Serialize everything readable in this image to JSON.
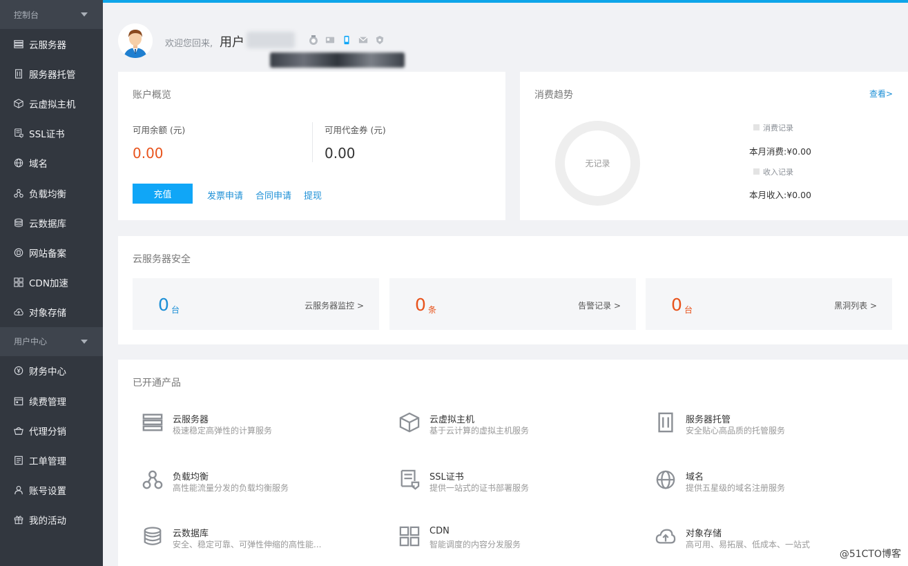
{
  "sidebar": {
    "section1": "控制台",
    "items1": [
      {
        "label": "云服务器",
        "icon": "server-icon"
      },
      {
        "label": "服务器托管",
        "icon": "rack-icon"
      },
      {
        "label": "云虚拟主机",
        "icon": "cube-icon"
      },
      {
        "label": "SSL证书",
        "icon": "certificate-icon"
      },
      {
        "label": "域名",
        "icon": "globe-icon"
      },
      {
        "label": "负载均衡",
        "icon": "balance-icon"
      },
      {
        "label": "云数据库",
        "icon": "database-icon"
      },
      {
        "label": "网站备案",
        "icon": "record-icon"
      },
      {
        "label": "CDN加速",
        "icon": "cdn-icon"
      },
      {
        "label": "对象存储",
        "icon": "cloud-upload-icon"
      }
    ],
    "section2": "用户中心",
    "items2": [
      {
        "label": "财务中心",
        "icon": "yen-icon"
      },
      {
        "label": "续费管理",
        "icon": "calendar-icon"
      },
      {
        "label": "代理分销",
        "icon": "basket-icon"
      },
      {
        "label": "工单管理",
        "icon": "ticket-icon"
      },
      {
        "label": "账号设置",
        "icon": "user-icon"
      },
      {
        "label": "我的活动",
        "icon": "gift-icon"
      }
    ]
  },
  "header": {
    "welcome": "欢迎您回来,",
    "username": "用户"
  },
  "account": {
    "title": "账户概览",
    "balance_label": "可用余额 (元)",
    "balance_value": "0.00",
    "voucher_label": "可用代金券 (元)",
    "voucher_value": "0.00",
    "charge_button": "充值",
    "links": [
      "发票申请",
      "合同申请",
      "提现"
    ]
  },
  "trend": {
    "title": "消费趋势",
    "more": "查看>",
    "donut_label": "无记录",
    "legend_spend": "消费记录",
    "spend_text": "本月消费:¥0.00",
    "legend_income": "收入记录",
    "income_text": "本月收入:¥0.00"
  },
  "security": {
    "title": "云服务器安全",
    "boxes": [
      {
        "num": "0",
        "unit": "台",
        "link": "云服务器监控 >",
        "color": "#1c8fd6"
      },
      {
        "num": "0",
        "unit": "条",
        "link": "告警记录 >",
        "color": "#e8531c"
      },
      {
        "num": "0",
        "unit": "台",
        "link": "黑洞列表 >",
        "color": "#e8531c"
      }
    ]
  },
  "products": {
    "title": "已开通产品",
    "items": [
      {
        "name": "云服务器",
        "desc": "极速稳定高弹性的计算服务",
        "icon": "server-icon"
      },
      {
        "name": "云虚拟主机",
        "desc": "基于云计算的虚拟主机服务",
        "icon": "cube-icon"
      },
      {
        "name": "服务器托管",
        "desc": "安全贴心高品质的托管服务",
        "icon": "rack-icon"
      },
      {
        "name": "负载均衡",
        "desc": "高性能流量分发的负载均衡服务",
        "icon": "balance-icon"
      },
      {
        "name": "SSL证书",
        "desc": "提供一站式的证书部署服务",
        "icon": "certificate-icon"
      },
      {
        "name": "域名",
        "desc": "提供五星级的域名注册服务",
        "icon": "globe-icon"
      },
      {
        "name": "云数据库",
        "desc": "安全、稳定可靠、可弹性伸缩的高性能...",
        "icon": "database-icon"
      },
      {
        "name": "CDN",
        "desc": "智能调度的内容分发服务",
        "icon": "cdn-icon"
      },
      {
        "name": "对象存储",
        "desc": "高可用、易拓展、低成本、一站式",
        "icon": "cloud-upload-icon"
      }
    ]
  },
  "watermark": "@51CTO博客",
  "colors": {
    "accent": "#10a6f7",
    "orange": "#e8531c",
    "sidebar": "#32373f"
  }
}
